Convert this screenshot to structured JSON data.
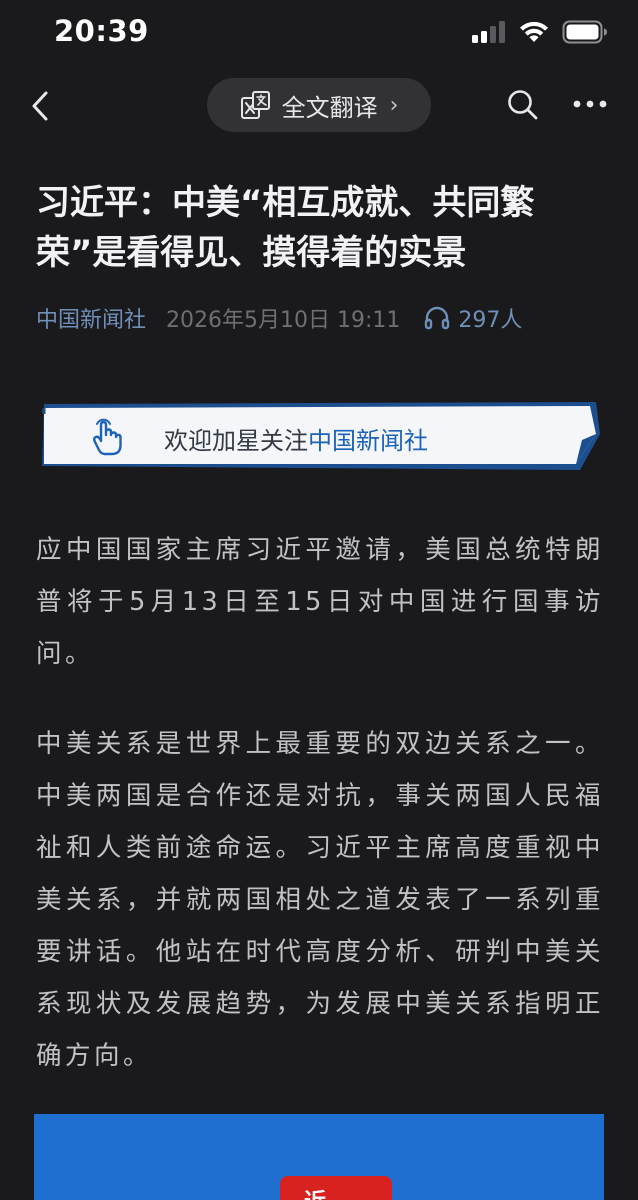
{
  "status_bar": {
    "time": "20:39",
    "icons": [
      "cellular-signal-icon",
      "wifi-icon",
      "battery-icon"
    ]
  },
  "nav": {
    "back_icon": "chevron-left-icon",
    "translate_label": "全文翻译",
    "translate_chevron": "›",
    "search_icon": "search-icon",
    "more_icon": "more-dots-icon"
  },
  "article": {
    "title": "习近平：中美“相互成就、共同繁荣”是看得见、摸得着的实景",
    "source": "中国新闻社",
    "date": "2026年5月10日 19:11",
    "listeners": "297人"
  },
  "follow_banner": {
    "prefix": "欢迎加星关注",
    "highlight": "中国新闻社"
  },
  "paragraphs": [
    "应中国国家主席习近平邀请，美国总统特朗普将于5月13日至15日对中国进行国事访问。",
    "中美关系是世界上最重要的双边关系之一。中美两国是合作还是对抗，事关两国人民福祉和人类前途命运。习近平主席高度重视中美关系，并就两国相处之道发表了一系列重要讲话。他站在时代高度分析、研判中美关系现状及发展趋势，为发展中美关系指明正确方向。"
  ],
  "image": {
    "logo_glyph": "近"
  },
  "colors": {
    "background": "#1a1a1c",
    "accent_blue": "#6f8fb8",
    "banner_highlight": "#1d63b8",
    "image_blue": "#1f6fd0",
    "logo_red": "#d7221f"
  }
}
